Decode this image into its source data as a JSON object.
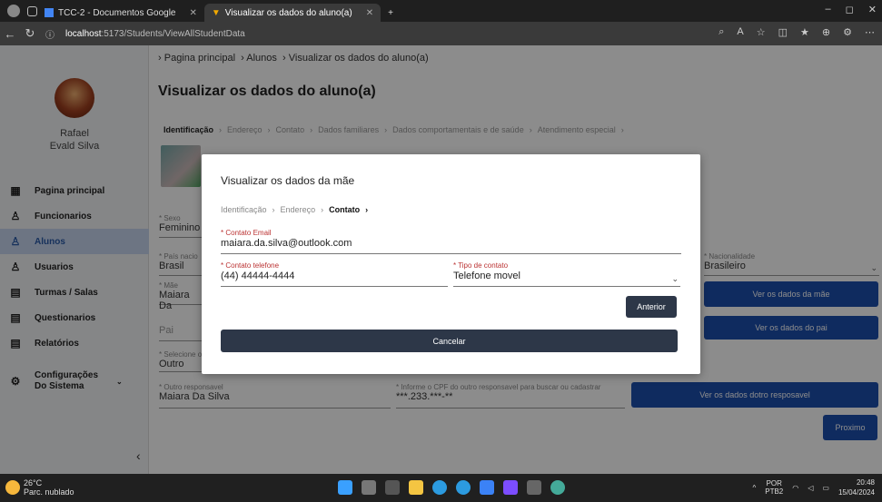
{
  "browser": {
    "tabs": [
      {
        "title": "TCC-2 - Documentos Google"
      },
      {
        "title": "Visualizar os dados do aluno(a)"
      }
    ],
    "url_host": "localhost",
    "url_rest": ":5173/Students/ViewAllStudentData"
  },
  "sidebar": {
    "user_first": "Rafael",
    "user_last": "Evald Silva",
    "items": [
      {
        "label": "Pagina principal",
        "icon": "grid-icon"
      },
      {
        "label": "Funcionarios",
        "icon": "person-icon"
      },
      {
        "label": "Alunos",
        "icon": "person-icon"
      },
      {
        "label": "Usuarios",
        "icon": "person-icon"
      },
      {
        "label": "Turmas / Salas",
        "icon": "document-icon"
      },
      {
        "label": "Questionarios",
        "icon": "document-icon"
      },
      {
        "label": "Relatórios",
        "icon": "document-icon"
      },
      {
        "label": "Configurações Do Sistema",
        "icon": "gear-icon"
      }
    ]
  },
  "main": {
    "breadcrumb": [
      "Pagina principal",
      "Alunos",
      "Visualizar os dados do aluno(a)"
    ],
    "title": "Visualizar os dados do aluno(a)",
    "steps": [
      "Identificação",
      "Endereço",
      "Contato",
      "Dados familiares",
      "Dados comportamentais e de saúde",
      "Atendimento especial"
    ],
    "fields": {
      "sexo_label": "* Sexo",
      "sexo_value": "Feminino",
      "pais_label": "* País nacio",
      "pais_value": "Brasil",
      "nacionalidade_label": "* Nacionalidade",
      "nacionalidade_value": "Brasileiro",
      "mae_label": "* Mãe",
      "mae_value": "Maiara Da",
      "pai_label": "Pai",
      "selecione_label": "* Selecione o",
      "selecione_value": "Outro",
      "outro_label": "* Outro responsavel",
      "outro_value": "Maiara Da Silva",
      "cpf_label": "* Informe o CPF do outro responsavel para buscar ou cadastrar",
      "cpf_value": "***.233.***-**"
    },
    "buttons": {
      "mae": "Ver os dados da mãe",
      "pai": "Ver os dados do pai",
      "outro": "Ver os dados dotro resposavel",
      "next": "Proximo"
    }
  },
  "modal": {
    "title": "Visualizar os dados da mãe",
    "steps": [
      "Identificação",
      "Endereço",
      "Contato"
    ],
    "email_label": "* Contato Email",
    "email_value": "maiara.da.silva@outlook.com",
    "phone_label": "* Contato telefone",
    "phone_value": "(44) 44444-4444",
    "type_label": "* Tipo de contato",
    "type_value": "Telefone movel",
    "prev_button": "Anterior",
    "cancel_button": "Cancelar"
  },
  "taskbar": {
    "temp": "26°C",
    "weather": "Parc. nublado",
    "lang": "POR",
    "layout": "PTB2",
    "time": "20:48",
    "date": "15/04/2024"
  }
}
